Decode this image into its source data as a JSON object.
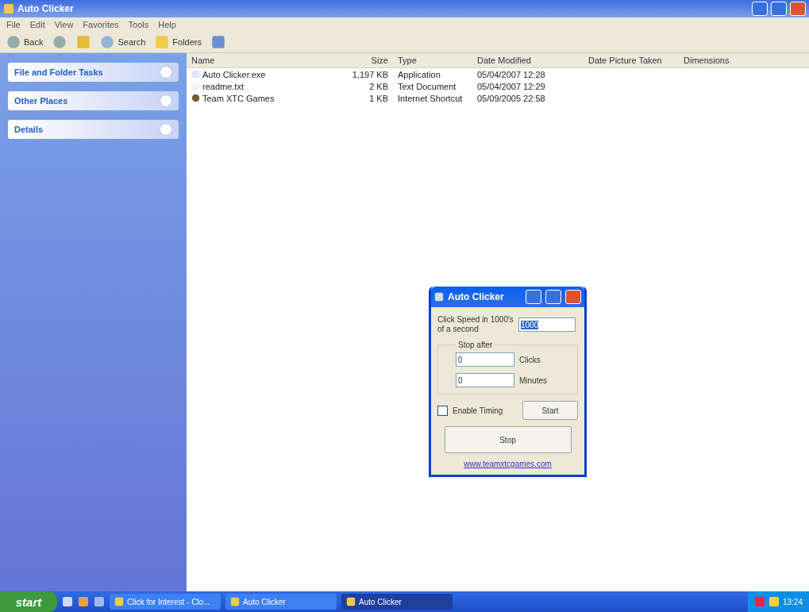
{
  "window": {
    "title": "Auto Clicker"
  },
  "menu": [
    "File",
    "Edit",
    "View",
    "Favorites",
    "Tools",
    "Help"
  ],
  "toolbar": {
    "back": "Back",
    "search": "Search",
    "folders": "Folders"
  },
  "sidebar": {
    "sections": [
      {
        "title": "File and Folder Tasks",
        "expanded": false
      },
      {
        "title": "Other Places",
        "expanded": false
      },
      {
        "title": "Details",
        "expanded": false
      }
    ]
  },
  "table": {
    "columns": [
      "Name",
      "Size",
      "Type",
      "Date Modified",
      "Date Picture Taken",
      "Dimensions"
    ],
    "rows": [
      {
        "kind": "app",
        "name": "Auto Clicker.exe",
        "size": "1,197 KB",
        "type": "Application",
        "modified": "05/04/2007 12:28"
      },
      {
        "kind": "text",
        "name": "readme.txt",
        "size": "2 KB",
        "type": "Text Document",
        "modified": "05/04/2007 12:29"
      },
      {
        "kind": "shortcut",
        "name": "Team XTC Games",
        "size": "1 KB",
        "type": "Internet Shortcut",
        "modified": "05/09/2005 22:58"
      }
    ]
  },
  "dialog": {
    "title": "Auto Clicker",
    "speed_label": "Click Speed in 1000's of a second",
    "speed_value": "1000",
    "speed_selected": true,
    "group_label": "Stop after",
    "clicks_value": "0",
    "clicks_label": "Clicks",
    "minutes_value": "0",
    "minutes_label": "Minutes",
    "timing": {
      "label": "Enable Timing",
      "checked": false
    },
    "start": "Start",
    "stop": "Stop",
    "link": "www.teamxtcgames.com"
  },
  "taskbar": {
    "start": "start",
    "tasks": [
      {
        "label": "Click for Interest - Clo...",
        "selected": false
      },
      {
        "label": "Auto Clicker",
        "selected": false
      },
      {
        "label": "Auto Clicker",
        "selected": true
      }
    ],
    "clock": "13:24"
  }
}
